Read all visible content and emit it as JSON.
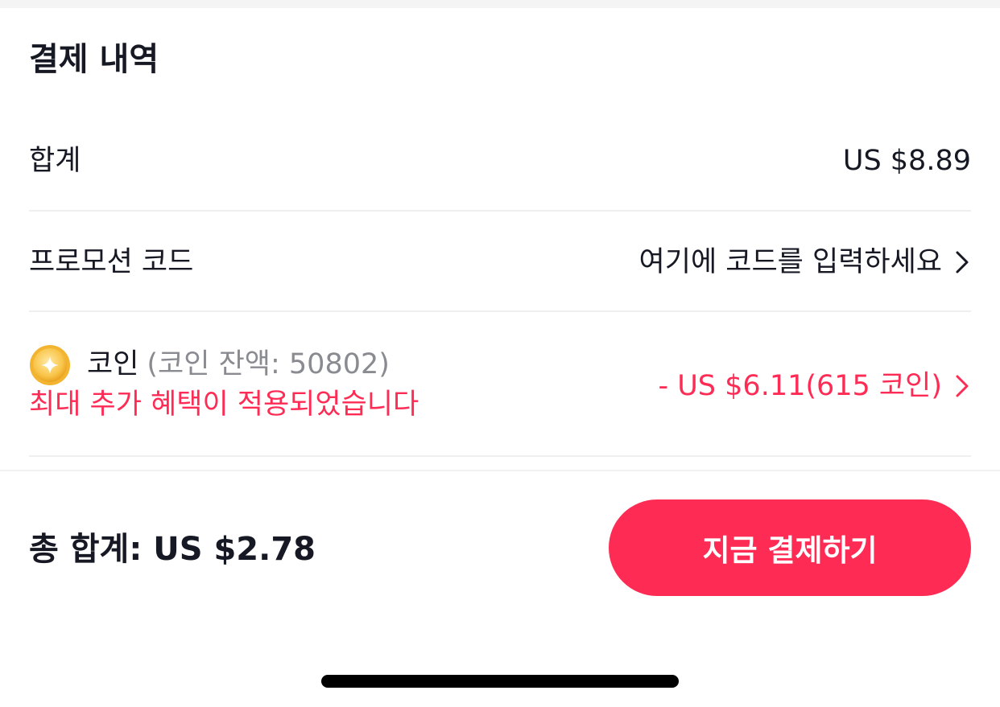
{
  "section_title": "결제 내역",
  "subtotal": {
    "label": "합계",
    "value": "US $8.89"
  },
  "promo": {
    "label": "프로모션 코드",
    "placeholder": "여기에 코드를 입력하세요"
  },
  "coins": {
    "label": "코인",
    "balance": "(코인 잔액: 50802)",
    "note": "최대 추가 혜택이 적용되었습니다",
    "value": "- US $6.11(615 코인)"
  },
  "footer": {
    "total": "총 합계: US $2.78",
    "pay_button": "지금 결제하기"
  },
  "colors": {
    "accent": "#fe2c55",
    "text_primary": "#161823",
    "text_secondary": "#8a8b91",
    "divider": "#efefef"
  },
  "icons": {
    "coin": "coin-icon",
    "chevron": "chevron-right-icon"
  }
}
